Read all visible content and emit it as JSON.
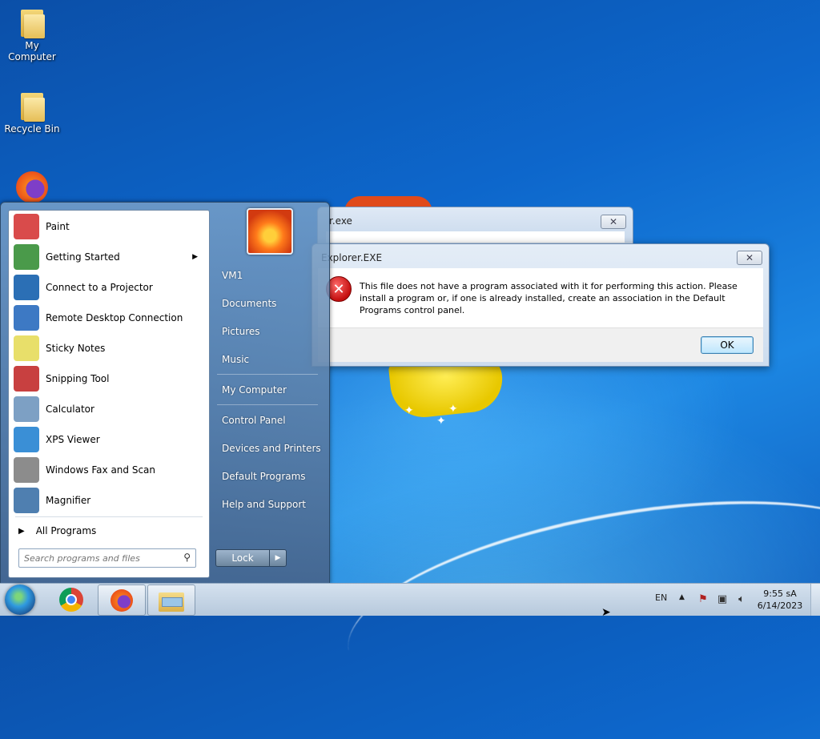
{
  "desktop": {
    "icons": [
      {
        "label": "My Computer",
        "icon": "folder-icon"
      },
      {
        "label": "Recycle Bin",
        "icon": "folder-icon"
      },
      {
        "label": "",
        "icon": "firefox-icon"
      }
    ]
  },
  "start_menu": {
    "programs": [
      {
        "label": "Paint",
        "icon": "paint-icon",
        "color": "#d94b4b",
        "has_submenu": false
      },
      {
        "label": "Getting Started",
        "icon": "getting-started-icon",
        "color": "#4a9a4a",
        "has_submenu": true
      },
      {
        "label": "Connect to a Projector",
        "icon": "projector-icon",
        "color": "#2b6fb5",
        "has_submenu": false
      },
      {
        "label": "Remote Desktop Connection",
        "icon": "remote-desktop-icon",
        "color": "#3d79c4",
        "has_submenu": false
      },
      {
        "label": "Sticky Notes",
        "icon": "sticky-notes-icon",
        "color": "#e8df6a",
        "has_submenu": false
      },
      {
        "label": "Snipping Tool",
        "icon": "scissors-icon",
        "color": "#c84040",
        "has_submenu": false
      },
      {
        "label": "Calculator",
        "icon": "calculator-icon",
        "color": "#7da0c4",
        "has_submenu": false
      },
      {
        "label": "XPS Viewer",
        "icon": "xps-viewer-icon",
        "color": "#3a8fd6",
        "has_submenu": false
      },
      {
        "label": "Windows Fax and Scan",
        "icon": "fax-icon",
        "color": "#8c8c8c",
        "has_submenu": false
      },
      {
        "label": "Magnifier",
        "icon": "magnifier-icon",
        "color": "#4f7fb0",
        "has_submenu": false
      }
    ],
    "all_programs": "All Programs",
    "search_placeholder": "Search programs and files",
    "right_items": [
      "VM1",
      "Documents",
      "Pictures",
      "Music",
      "My Computer",
      "Control Panel",
      "Devices and Printers",
      "Default Programs",
      "Help and Support"
    ],
    "lock_label": "Lock"
  },
  "background_window": {
    "title": "r.exe",
    "close": "✕"
  },
  "dialog": {
    "title": "Explorer.EXE",
    "close": "✕",
    "error_glyph": "✕",
    "message": "This file does not have a program associated with it for performing this action. Please install a program or, if one is already installed, create an association in the Default Programs control panel.",
    "ok_label": "OK"
  },
  "taskbar": {
    "language": "EN",
    "time": "9:55 sA",
    "date": "6/14/2023",
    "tray_icons": [
      "action-center-icon",
      "network-icon",
      "volume-muted-icon"
    ]
  }
}
